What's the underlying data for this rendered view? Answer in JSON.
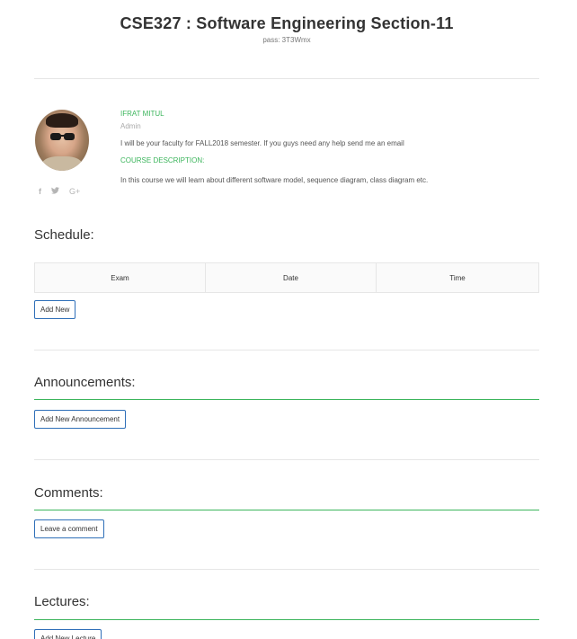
{
  "course": {
    "title": "CSE327 : Software Engineering Section-11",
    "pass": "pass: 3T3Wmx"
  },
  "faculty": {
    "name": "IFRAT MITUL",
    "role": "Admin",
    "message": "I will be your faculty for FALL2018 semester. If you guys need any help send me an email",
    "course_description_label": "COURSE DESCRIPTION:",
    "course_description": "In this course we will learn about different software model, sequence diagram, class diagram etc.",
    "socials": {
      "facebook": "f",
      "twitter": "🐦",
      "googleplus": "G+"
    }
  },
  "schedule": {
    "title": "Schedule:",
    "columns": [
      "Exam",
      "Date",
      "Time"
    ],
    "add_label": "Add New"
  },
  "announcements": {
    "title": "Announcements:",
    "add_label": "Add New Announcement"
  },
  "comments": {
    "title": "Comments:",
    "add_label": "Leave a comment"
  },
  "lectures": {
    "title": "Lectures:",
    "add_label": "Add New Lecture"
  }
}
